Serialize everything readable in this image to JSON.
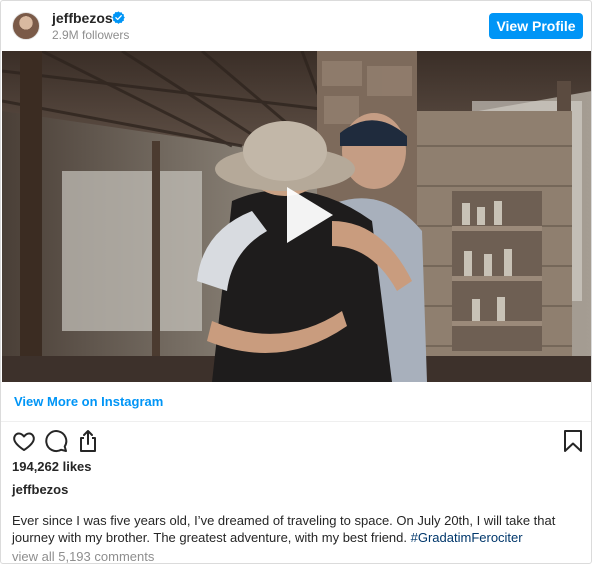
{
  "header": {
    "username": "jeffbezos",
    "followers": "2.9M followers",
    "view_profile_label": "View Profile",
    "verified_icon": "verified-badge-icon",
    "accent_color": "#0095f6"
  },
  "media": {
    "type": "video",
    "play_icon": "play-icon"
  },
  "links": {
    "view_more": "View More on Instagram"
  },
  "actions": {
    "like_icon": "heart-icon",
    "comment_icon": "comment-icon",
    "share_icon": "share-icon",
    "save_icon": "bookmark-icon"
  },
  "post": {
    "likes": "194,262 likes",
    "caption_username": "jeffbezos",
    "caption_text": "Ever since I was five years old, I’ve dreamed of traveling to space. On July 20th, I will take that journey with my brother. The greatest adventure, with my best friend. ",
    "hashtag": "#GradatimFerociter",
    "view_comments": "view all 5,193 comments"
  }
}
